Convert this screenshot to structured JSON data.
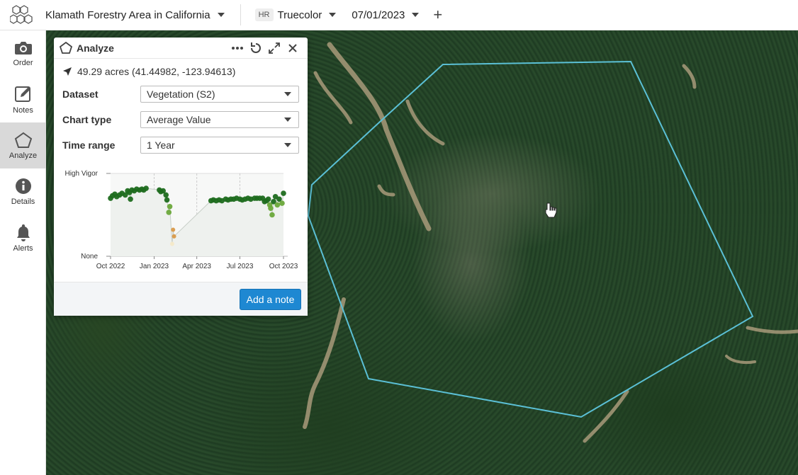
{
  "topbar": {
    "area_name": "Klamath Forestry Area in California",
    "layer_badge": "HR",
    "layer_name": "Truecolor",
    "date": "07/01/2023",
    "add_label": "+"
  },
  "sidebar": {
    "items": [
      {
        "label": "Order",
        "icon": "camera-icon"
      },
      {
        "label": "Notes",
        "icon": "edit-note-icon"
      },
      {
        "label": "Analyze",
        "icon": "pentagon-icon",
        "active": true
      },
      {
        "label": "Details",
        "icon": "info-icon"
      },
      {
        "label": "Alerts",
        "icon": "bell-icon"
      }
    ]
  },
  "panel": {
    "title": "Analyze",
    "stats": "49.29 acres (41.44982, -123.94613)",
    "dataset_label": "Dataset",
    "dataset_value": "Vegetation (S2)",
    "chart_type_label": "Chart type",
    "chart_type_value": "Average Value",
    "time_range_label": "Time range",
    "time_range_value": "1 Year",
    "add_note_label": "Add a note"
  },
  "colors": {
    "accent": "#1e88d2",
    "polygon": "#5bc0d6",
    "high_vigor": "#1e6b1e",
    "mid_vigor": "#6aa83a",
    "low_vigor": "#d99a4a"
  },
  "chart_data": {
    "type": "scatter",
    "title": "",
    "xlabel": "",
    "ylabel": "",
    "y_tick_labels": [
      "High Vigor",
      "None"
    ],
    "x_tick_labels": [
      "Oct 2022",
      "Jan 2023",
      "Apr 2023",
      "Jul 2023",
      "Oct 2023"
    ],
    "xlim": [
      "2022-10-01",
      "2023-10-01"
    ],
    "ylim": [
      0,
      1
    ],
    "grid": true,
    "series": [
      {
        "points": [
          [
            "2022-10-01",
            0.7
          ],
          [
            "2022-10-05",
            0.73
          ],
          [
            "2022-10-10",
            0.75
          ],
          [
            "2022-10-14",
            0.72
          ],
          [
            "2022-10-20",
            0.74
          ],
          [
            "2022-10-25",
            0.76
          ],
          [
            "2022-11-01",
            0.74
          ],
          [
            "2022-11-06",
            0.79
          ],
          [
            "2022-11-10",
            0.77
          ],
          [
            "2022-11-15",
            0.8
          ],
          [
            "2022-11-20",
            0.79
          ],
          [
            "2022-11-25",
            0.81
          ],
          [
            "2022-12-01",
            0.8
          ],
          [
            "2022-12-06",
            0.81
          ],
          [
            "2022-12-10",
            0.8
          ],
          [
            "2022-12-15",
            0.82
          ],
          [
            "2022-11-12",
            0.69
          ],
          [
            "2023-01-12",
            0.8
          ],
          [
            "2023-01-15",
            0.78
          ],
          [
            "2023-01-20",
            0.79
          ],
          [
            "2023-01-26",
            0.74
          ],
          [
            "2023-01-28",
            0.68
          ],
          [
            "2023-02-01",
            0.53
          ],
          [
            "2023-02-03",
            0.6
          ],
          [
            "2023-02-10",
            0.32
          ],
          [
            "2023-02-12",
            0.24
          ],
          [
            "2023-02-08",
            0.15
          ],
          [
            "2023-05-01",
            0.67
          ],
          [
            "2023-05-06",
            0.68
          ],
          [
            "2023-05-12",
            0.67
          ],
          [
            "2023-05-18",
            0.68
          ],
          [
            "2023-05-24",
            0.67
          ],
          [
            "2023-06-01",
            0.69
          ],
          [
            "2023-06-06",
            0.68
          ],
          [
            "2023-06-12",
            0.69
          ],
          [
            "2023-06-18",
            0.69
          ],
          [
            "2023-06-24",
            0.7
          ],
          [
            "2023-07-01",
            0.69
          ],
          [
            "2023-07-06",
            0.68
          ],
          [
            "2023-07-12",
            0.69
          ],
          [
            "2023-07-18",
            0.7
          ],
          [
            "2023-07-24",
            0.69
          ],
          [
            "2023-08-01",
            0.7
          ],
          [
            "2023-08-06",
            0.7
          ],
          [
            "2023-08-12",
            0.7
          ],
          [
            "2023-08-18",
            0.7
          ],
          [
            "2023-08-22",
            0.66
          ],
          [
            "2023-08-26",
            0.67
          ],
          [
            "2023-08-30",
            0.69
          ],
          [
            "2023-09-02",
            0.62
          ],
          [
            "2023-09-04",
            0.58
          ],
          [
            "2023-09-07",
            0.5
          ],
          [
            "2023-09-10",
            0.66
          ],
          [
            "2023-09-14",
            0.72
          ],
          [
            "2023-09-18",
            0.62
          ],
          [
            "2023-09-22",
            0.69
          ],
          [
            "2023-09-28",
            0.64
          ],
          [
            "2023-10-01",
            0.76
          ]
        ]
      }
    ]
  }
}
